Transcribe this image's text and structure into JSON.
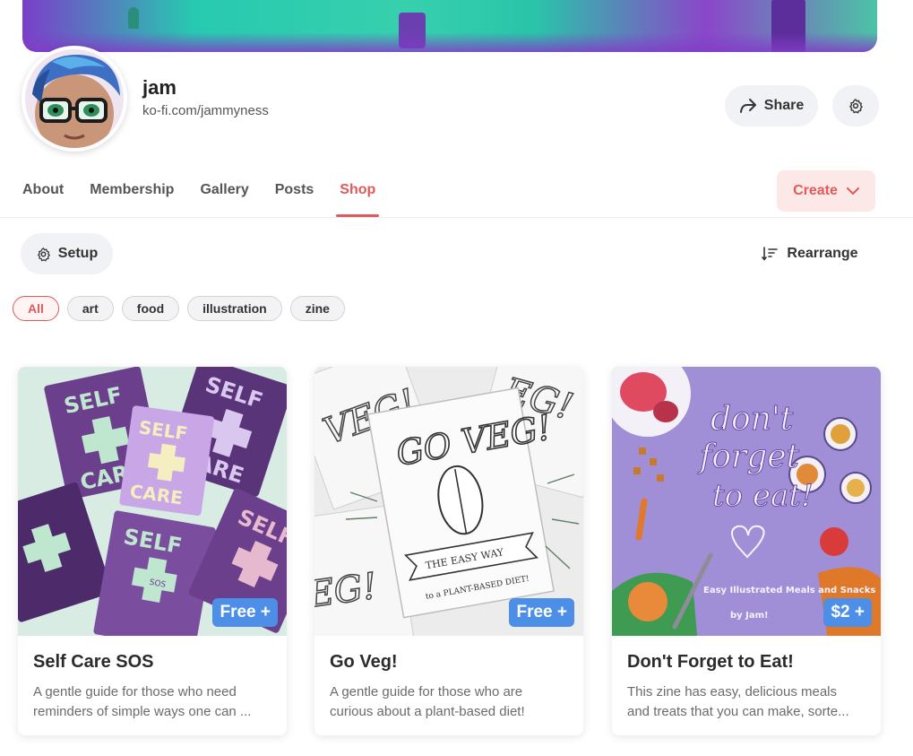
{
  "profile": {
    "name": "jam",
    "url": "ko-fi.com/jammyness"
  },
  "header": {
    "share_label": "Share"
  },
  "tabs": [
    {
      "label": "About"
    },
    {
      "label": "Membership"
    },
    {
      "label": "Gallery"
    },
    {
      "label": "Posts"
    },
    {
      "label": "Shop",
      "active": true
    }
  ],
  "create_label": "Create",
  "toolbar": {
    "setup_label": "Setup",
    "rearrange_label": "Rearrange"
  },
  "filters": [
    {
      "label": "All",
      "active": true
    },
    {
      "label": "art"
    },
    {
      "label": "food"
    },
    {
      "label": "illustration"
    },
    {
      "label": "zine"
    }
  ],
  "products": [
    {
      "title": "Self Care SOS",
      "price": "Free +",
      "desc_line1": "A gentle guide for those who need",
      "desc_line2": "reminders of simple ways one can ...",
      "cover_text_1": "SELF",
      "cover_text_2": "CARE",
      "cover_text_3": "SOS"
    },
    {
      "title": "Go Veg!",
      "price": "Free +",
      "desc_line1": "A gentle guide for those who are",
      "desc_line2": "curious about a plant-based diet!",
      "cover_text_1": "GO VEG!",
      "cover_text_2": "THE EASY WAY",
      "cover_text_3": "to a PLANT-BASED DIET!"
    },
    {
      "title": "Don't Forget to Eat!",
      "price": "$2 +",
      "desc_line1": "This zine has easy, delicious meals",
      "desc_line2": "and treats that you can make, sorte...",
      "cover_text_1": "don't",
      "cover_text_2": "forget",
      "cover_text_3": "to eat!",
      "cover_text_4": "Easy Illustrated Meals and Snacks",
      "cover_text_5": "by Jam!"
    }
  ],
  "colors": {
    "accent": "#e05a5a",
    "price_badge": "#4d8fe6",
    "pill_bg": "#f1f2f6"
  }
}
